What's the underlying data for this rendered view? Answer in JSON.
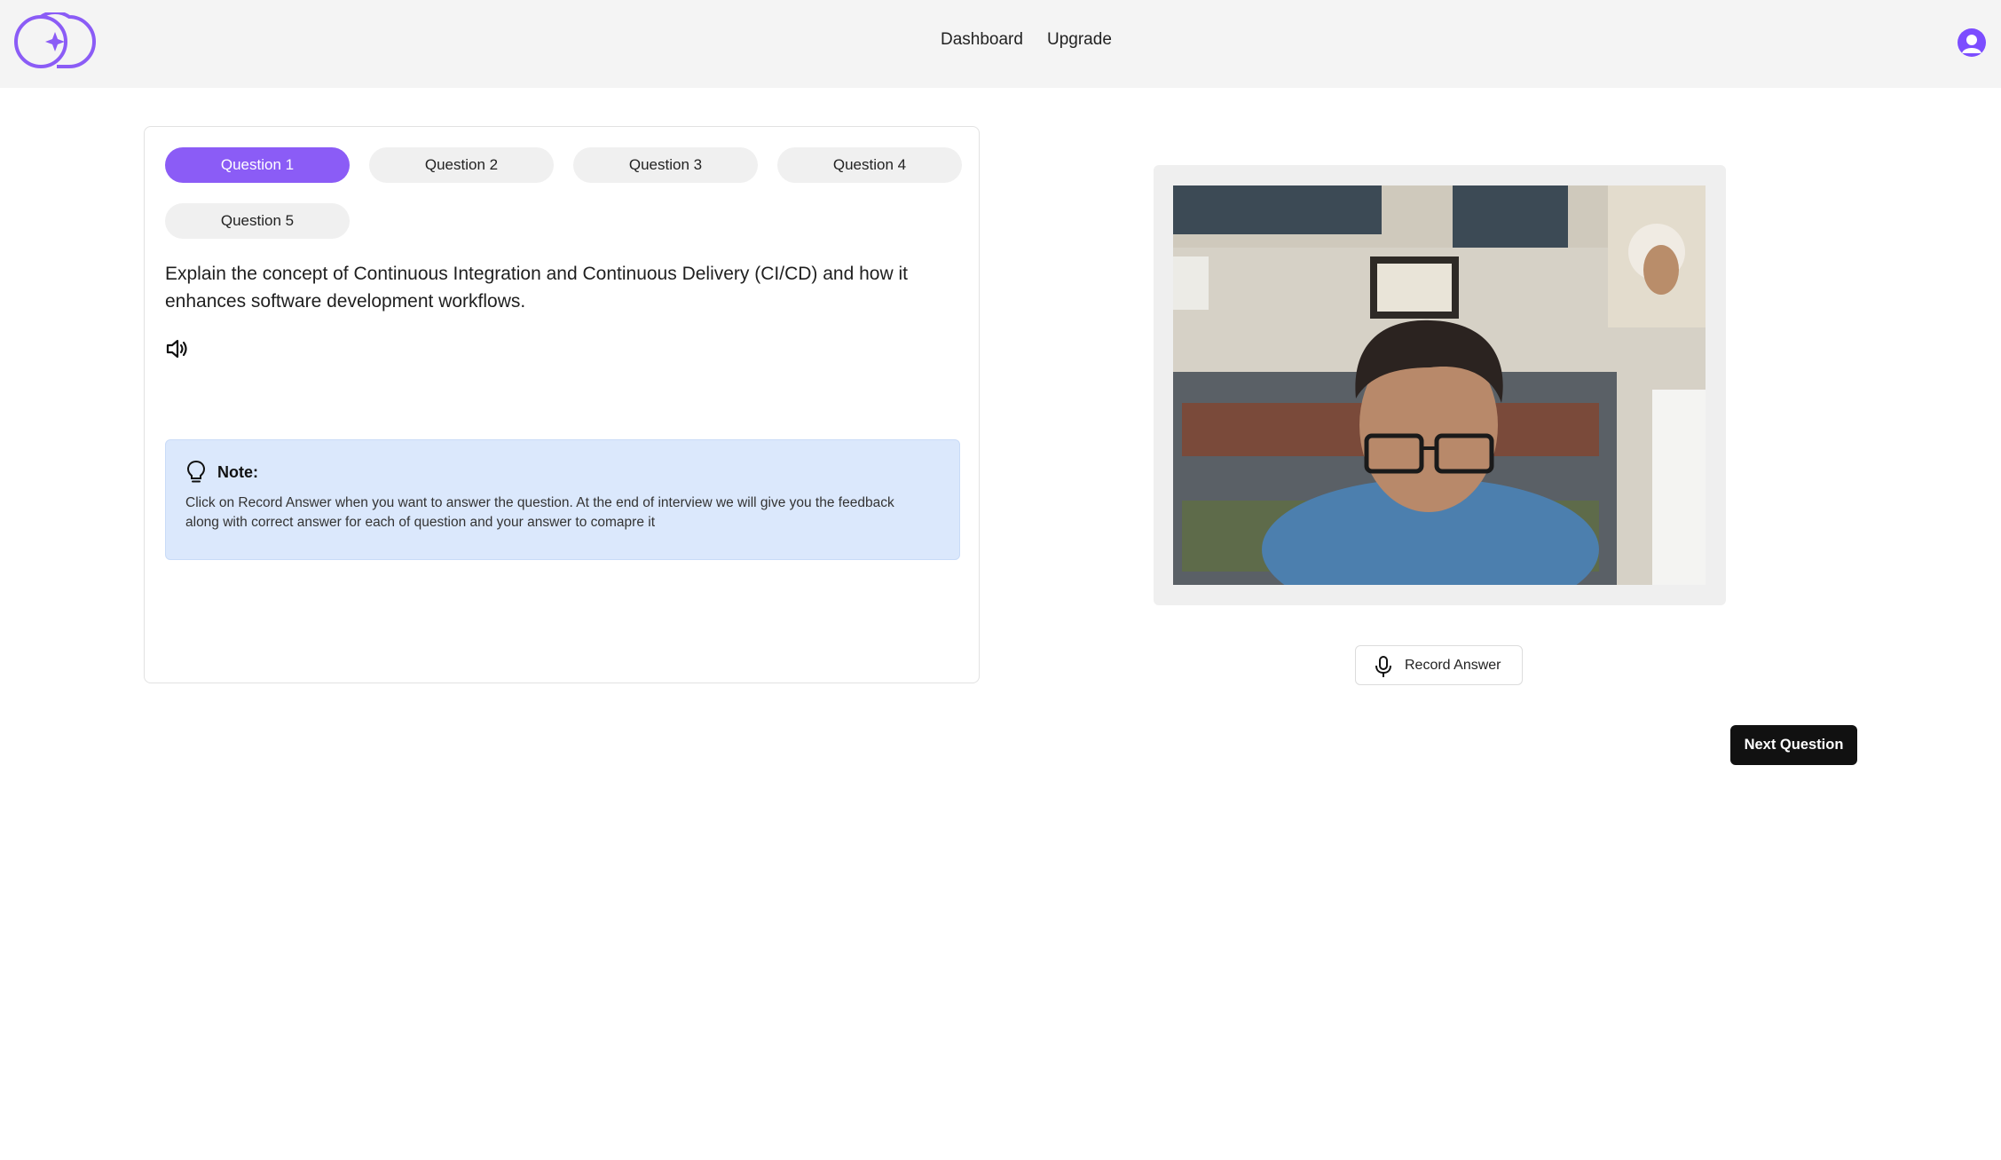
{
  "header": {
    "logo_icon": "brand-logo-icon",
    "nav": {
      "dashboard": "Dashboard",
      "upgrade": "Upgrade"
    },
    "avatar_icon": "user-avatar-icon"
  },
  "questions": {
    "tabs": [
      "Question 1",
      "Question 2",
      "Question 3",
      "Question 4",
      "Question 5"
    ],
    "active_index": 0,
    "current_text": "Explain the concept of Continuous Integration and Continuous Delivery (CI/CD) and how it enhances software development workflows.",
    "speaker_icon": "speaker-icon"
  },
  "note": {
    "icon": "lightbulb-icon",
    "title": "Note:",
    "body": "Click on Record Answer when you want to answer the question. At the end of interview we will give you the feedback along with correct answer for each of question and your answer to comapre it"
  },
  "camera": {
    "icon": "webcam-feed"
  },
  "actions": {
    "record_label": "Record Answer",
    "record_icon": "microphone-icon",
    "next_label": "Next Question"
  },
  "colors": {
    "accent": "#8b5cf6",
    "header_bg": "#f4f4f4",
    "note_bg": "#dbe8fc",
    "next_button_bg": "#111111"
  }
}
